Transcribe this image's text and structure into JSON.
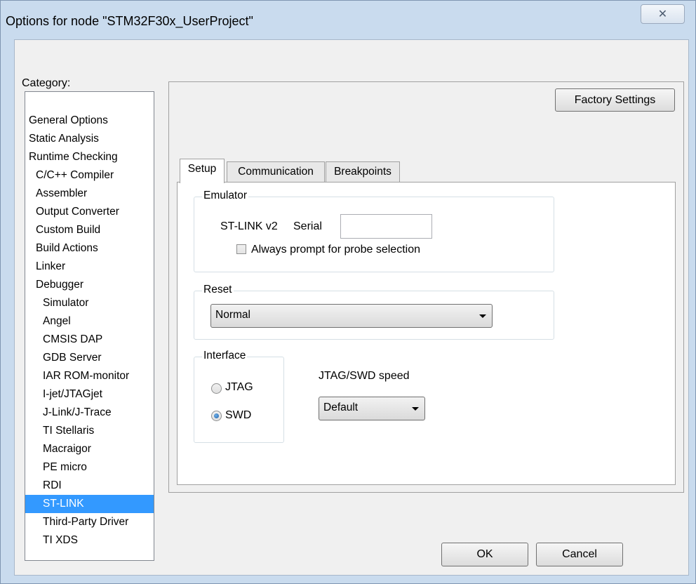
{
  "window": {
    "title": "Options for node \"STM32F30x_UserProject\"",
    "close_glyph": "✕"
  },
  "category": {
    "label": "Category:",
    "items": [
      {
        "label": "General Options",
        "level": 0
      },
      {
        "label": "Static Analysis",
        "level": 0
      },
      {
        "label": "Runtime Checking",
        "level": 0
      },
      {
        "label": "C/C++ Compiler",
        "level": 1
      },
      {
        "label": "Assembler",
        "level": 1
      },
      {
        "label": "Output Converter",
        "level": 1
      },
      {
        "label": "Custom Build",
        "level": 1
      },
      {
        "label": "Build Actions",
        "level": 1
      },
      {
        "label": "Linker",
        "level": 1
      },
      {
        "label": "Debugger",
        "level": 1
      },
      {
        "label": "Simulator",
        "level": 2
      },
      {
        "label": "Angel",
        "level": 2
      },
      {
        "label": "CMSIS DAP",
        "level": 2
      },
      {
        "label": "GDB Server",
        "level": 2
      },
      {
        "label": "IAR ROM-monitor",
        "level": 2
      },
      {
        "label": "I-jet/JTAGjet",
        "level": 2
      },
      {
        "label": "J-Link/J-Trace",
        "level": 2
      },
      {
        "label": "TI Stellaris",
        "level": 2
      },
      {
        "label": "Macraigor",
        "level": 2
      },
      {
        "label": "PE micro",
        "level": 2
      },
      {
        "label": "RDI",
        "level": 2
      },
      {
        "label": "ST-LINK",
        "level": 2,
        "selected": true
      },
      {
        "label": "Third-Party Driver",
        "level": 2
      },
      {
        "label": "TI XDS",
        "level": 2
      }
    ]
  },
  "factory_settings_label": "Factory Settings",
  "tabs": [
    {
      "label": "Setup",
      "active": true
    },
    {
      "label": "Communication",
      "active": false
    },
    {
      "label": "Breakpoints",
      "active": false
    }
  ],
  "emulator": {
    "group_label": "Emulator",
    "device_label": "ST-LINK v2",
    "serial_label": "Serial",
    "serial_value": "",
    "always_prompt_label": "Always prompt for probe selection",
    "always_prompt_checked": false
  },
  "reset": {
    "group_label": "Reset",
    "selected": "Normal"
  },
  "interface": {
    "group_label": "Interface",
    "options": [
      {
        "label": "JTAG",
        "selected": false
      },
      {
        "label": "SWD",
        "selected": true
      }
    ]
  },
  "speed": {
    "label": "JTAG/SWD speed",
    "selected": "Default"
  },
  "buttons": {
    "ok": "OK",
    "cancel": "Cancel"
  },
  "colors": {
    "selection": "#3399ff",
    "frame": "#c9dbee",
    "dialog_bg": "#f0f0f0"
  }
}
